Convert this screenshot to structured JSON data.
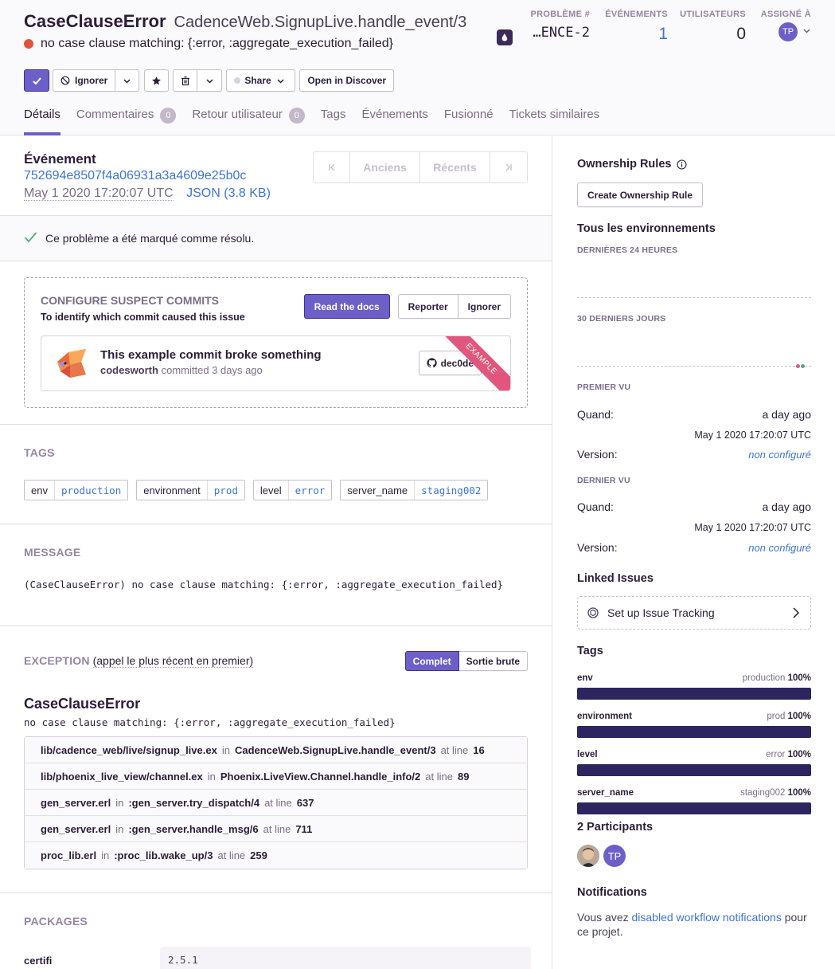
{
  "header": {
    "title": "CaseClauseError",
    "culprit": "CadenceWeb.SignupLive.handle_event/3",
    "message": "no case clause matching: {:error, :aggregate_execution_failed}",
    "stats": {
      "issue_label": "PROBLÈME #",
      "issue_value": "…ENCE-2",
      "events_label": "ÉVÉNEMENTS",
      "events_value": "1",
      "users_label": "UTILISATEURS",
      "users_value": "0",
      "assignee_label": "ASSIGNÉ À",
      "assignee_initials": "TP"
    }
  },
  "toolbar": {
    "ignore_label": "Ignorer",
    "share_label": "Share",
    "discover_label": "Open in Discover"
  },
  "tabs": [
    {
      "label": "Détails",
      "active": true
    },
    {
      "label": "Commentaires",
      "count": "0"
    },
    {
      "label": "Retour utilisateur",
      "count": "0"
    },
    {
      "label": "Tags"
    },
    {
      "label": "Événements"
    },
    {
      "label": "Fusionné"
    },
    {
      "label": "Tickets similaires"
    }
  ],
  "event": {
    "heading": "Événement",
    "id": "752694e8507f4a06931a3a4609e25b0c",
    "date": "May 1 2020 17:20:07 UTC",
    "json_link": "JSON (3.8 KB)",
    "pager": {
      "older": "Anciens",
      "newer": "Récents"
    }
  },
  "resolved_text": "Ce problème a été marqué comme résolu.",
  "suspect": {
    "title": "CONFIGURE SUSPECT COMMITS",
    "subtitle": "To identify which commit caused this issue",
    "read_docs": "Read the docs",
    "postpone": "Reporter",
    "ignore": "Ignorer",
    "commit_title": "This example commit broke something",
    "commit_author": "codesworth",
    "commit_meta": "committed 3 days ago",
    "commit_hash": "dec0de",
    "ribbon": "EXAMPLE"
  },
  "tags_section": {
    "heading": "TAGS",
    "items": [
      {
        "key": "env",
        "value": "production"
      },
      {
        "key": "environment",
        "value": "prod"
      },
      {
        "key": "level",
        "value": "error"
      },
      {
        "key": "server_name",
        "value": "staging002"
      }
    ]
  },
  "message_section": {
    "heading": "MESSAGE",
    "body": "(CaseClauseError) no case clause matching: {:error, :aggregate_execution_failed}"
  },
  "exception": {
    "heading": "EXCEPTION",
    "subheading": "(appel le plus récent en premier)",
    "toggle_full": "Complet",
    "toggle_raw": "Sortie brute",
    "type": "CaseClauseError",
    "value": "no case clause matching: {:error, :aggregate_execution_failed}",
    "in_word": "in",
    "at_line_word": "at line",
    "frames": [
      {
        "file": "lib/cadence_web/live/signup_live.ex",
        "function": "CadenceWeb.SignupLive.handle_event/3",
        "line": "16"
      },
      {
        "file": "lib/phoenix_live_view/channel.ex",
        "function": "Phoenix.LiveView.Channel.handle_info/2",
        "line": "89"
      },
      {
        "file": "gen_server.erl",
        "function": ":gen_server.try_dispatch/4",
        "line": "637"
      },
      {
        "file": "gen_server.erl",
        "function": ":gen_server.handle_msg/6",
        "line": "711"
      },
      {
        "file": "proc_lib.erl",
        "function": ":proc_lib.wake_up/3",
        "line": "259"
      }
    ]
  },
  "packages": {
    "heading": "PACKAGES",
    "items": [
      {
        "name": "certifi",
        "version": "2.5.1"
      }
    ]
  },
  "sidebar": {
    "ownership_heading": "Ownership Rules",
    "create_rule": "Create Ownership Rule",
    "all_envs": "Tous les environnements",
    "last_24h": "DERNIÈRES 24 HEURES",
    "last_30d": "30 DERNIERS JOURS",
    "first_seen": {
      "heading": "PREMIER VU",
      "when_label": "Quand:",
      "when_value": "a day ago",
      "date": "May 1 2020 17:20:07 UTC",
      "version_label": "Version:",
      "version_value": "non configuré"
    },
    "last_seen": {
      "heading": "DERNIER VU",
      "when_label": "Quand:",
      "when_value": "a day ago",
      "date": "May 1 2020 17:20:07 UTC",
      "version_label": "Version:",
      "version_value": "non configuré"
    },
    "linked_heading": "Linked Issues",
    "linked_text": "Set up Issue Tracking",
    "tags_heading": "Tags",
    "tag_bars": [
      {
        "key": "env",
        "value": "production",
        "pct": "100%",
        "fill": 1.0
      },
      {
        "key": "environment",
        "value": "prod",
        "pct": "100%",
        "fill": 1.0
      },
      {
        "key": "level",
        "value": "error",
        "pct": "100%",
        "fill": 1.0
      },
      {
        "key": "server_name",
        "value": "staging002",
        "pct": "100%",
        "fill": 1.0
      }
    ],
    "participants_heading": "2 Participants",
    "participant_initials": "TP",
    "notifications_heading": "Notifications",
    "notif_prefix": "Vous avez ",
    "notif_link": "disabled workflow notifications",
    "notif_suffix": " pour ce projet."
  },
  "colors": {
    "accent": "#6c5fc7",
    "link": "#3d74db",
    "error": "#e2533b",
    "tag_bar": "#2d2560"
  }
}
